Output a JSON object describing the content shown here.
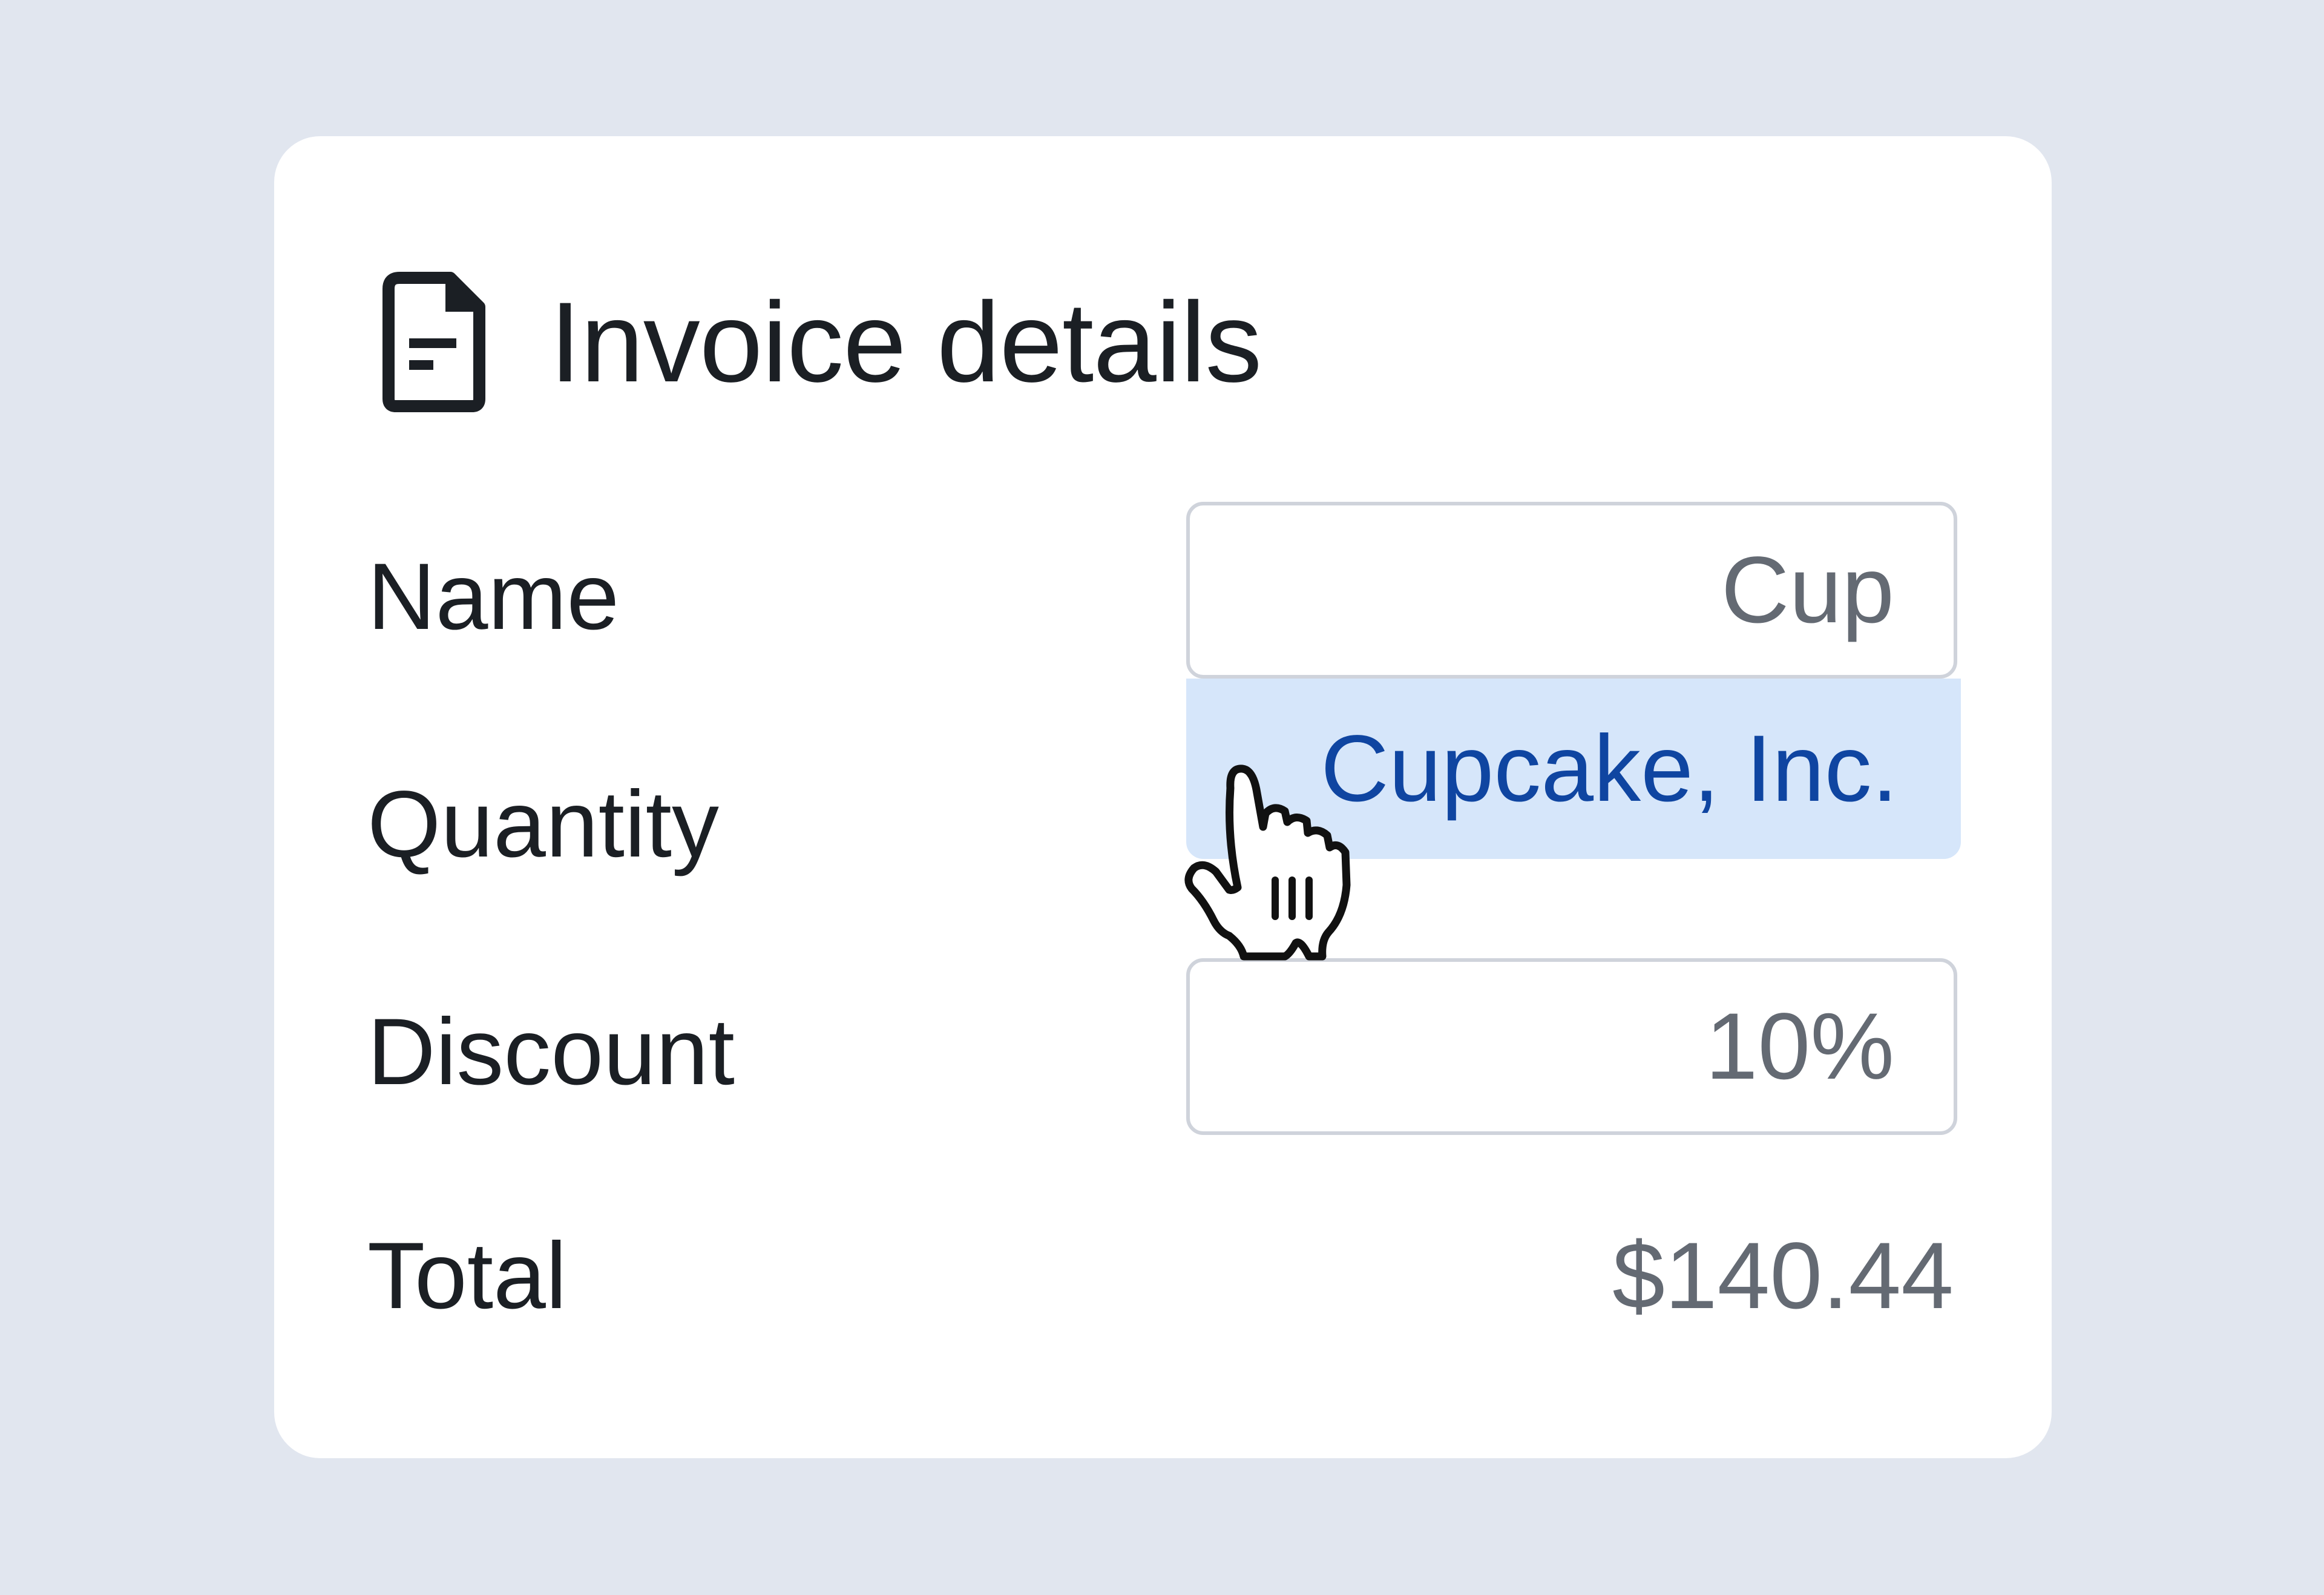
{
  "header": {
    "icon": "document-icon",
    "title": "Invoice details"
  },
  "form": {
    "name_label": "Name",
    "name_value": "Cup",
    "suggestion": "Cupcake, Inc.",
    "quantity_label": "Quantity",
    "discount_label": "Discount",
    "discount_value": "10%",
    "total_label": "Total",
    "total_value": "$140.44"
  },
  "colors": {
    "background": "#e1e6ef",
    "card": "#ffffff",
    "suggestion_bg": "#d6e6fa",
    "suggestion_text": "#0f45a1",
    "value_text": "#646a73"
  },
  "cursor": "hand-pointer-icon"
}
